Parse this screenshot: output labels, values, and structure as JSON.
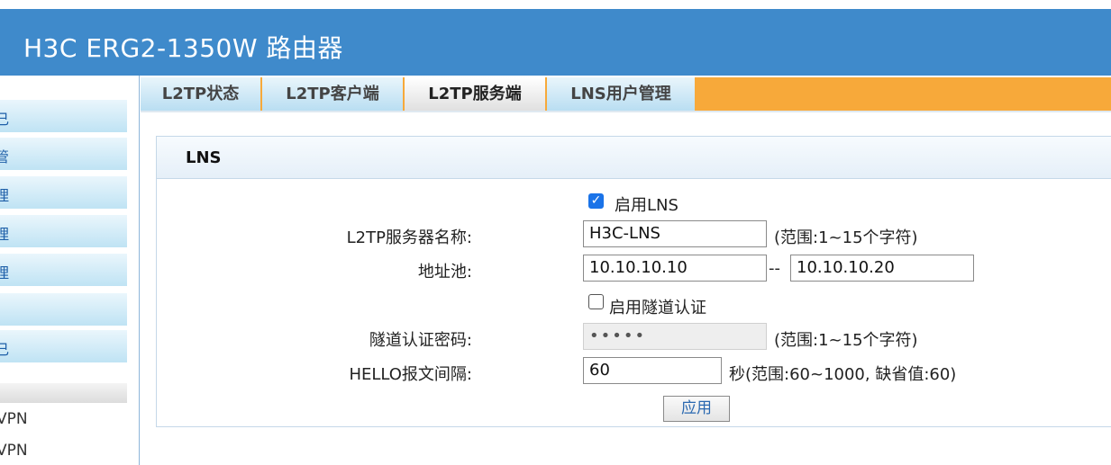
{
  "app": {
    "title": "H3C ERG2-1350W 路由器"
  },
  "sidebar": {
    "items": [
      "己",
      "管",
      "理",
      "理",
      "理",
      "",
      "己"
    ],
    "links": [
      "VPN",
      "VPN"
    ]
  },
  "tabs": [
    {
      "label": "L2TP状态",
      "active": false
    },
    {
      "label": "L2TP客户端",
      "active": false
    },
    {
      "label": "L2TP服务端",
      "active": true
    },
    {
      "label": "LNS用户管理",
      "active": false
    }
  ],
  "panel": {
    "title": "LNS",
    "enable_lns": {
      "label": "启用LNS",
      "checked": true
    },
    "server_name": {
      "label": "L2TP服务器名称:",
      "value": "H3C-LNS",
      "hint": "(范围:1~15个字符)"
    },
    "address_pool": {
      "label": "地址池:",
      "start": "10.10.10.10",
      "separator": "--",
      "end": "10.10.10.20"
    },
    "tunnel_auth": {
      "label": "启用隧道认证",
      "checked": false
    },
    "tunnel_password": {
      "label": "隧道认证密码:",
      "value": "•••••",
      "hint": "(范围:1~15个字符)"
    },
    "hello_interval": {
      "label": "HELLO报文间隔:",
      "value": "60",
      "hint": "秒(范围:60~1000, 缺省值:60)"
    },
    "apply_label": "应用"
  },
  "colors": {
    "header": "#3f8acb",
    "tabbar": "#f7a93a",
    "checkbox": "#1a73e8"
  }
}
